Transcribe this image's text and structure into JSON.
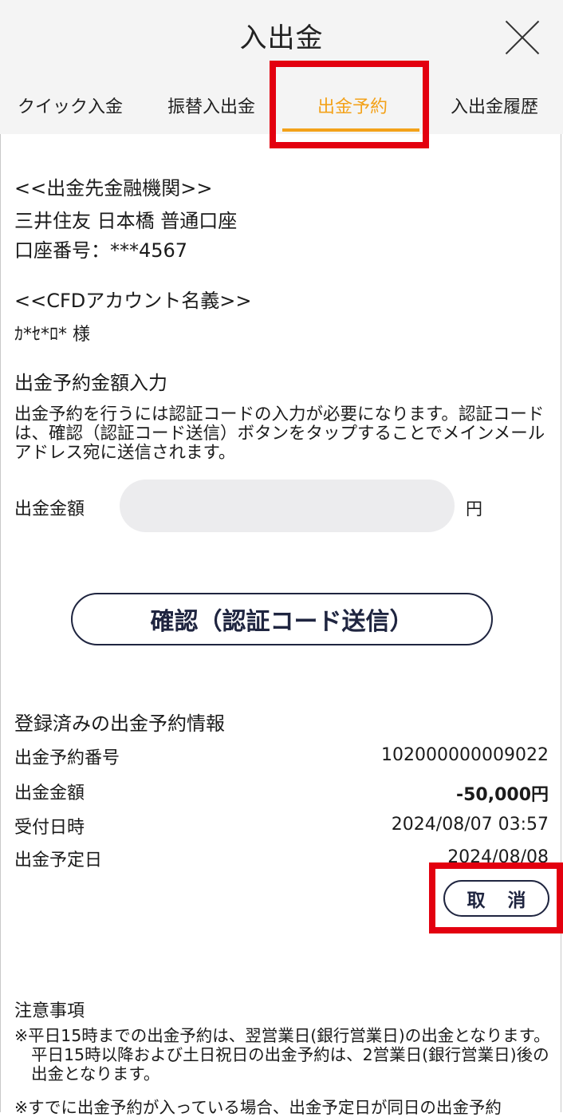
{
  "header": {
    "title": "入出金",
    "tabs": [
      {
        "label": "クイック入金"
      },
      {
        "label": "振替入出金"
      },
      {
        "label": "出金予約"
      },
      {
        "label": "入出金履歴"
      }
    ],
    "active_tab": "出金予約"
  },
  "bank": {
    "heading": "<<出金先金融機関>>",
    "name_line": "三井住友 日本橋 普通口座",
    "account_line": "口座番号：***4567"
  },
  "account": {
    "heading": "<<CFDアカウント名義>>",
    "holder": "ｶ*ｾ*ﾛ* 様"
  },
  "withdraw_input": {
    "heading": "出金予約金額入力",
    "description": "出金予約を行うには認証コードの入力が必要になります。認証コードは、確認（認証コード送信）ボタンをタップすることでメインメールアドレス宛に送信されます。",
    "amount_label": "出金金額",
    "amount_value": "",
    "unit": "円",
    "confirm_button": "確認（認証コード送信）"
  },
  "registered": {
    "heading": "登録済みの出金予約情報",
    "rows": [
      {
        "label": "出金予約番号",
        "value": "102000000009022"
      },
      {
        "label": "出金金額",
        "value": "-50,000円"
      },
      {
        "label": "受付日時",
        "value": "2024/08/07 03:57"
      },
      {
        "label": "出金予定日",
        "value": "2024/08/08"
      }
    ],
    "cancel_button": "取 消"
  },
  "notes": {
    "heading": "注意事項",
    "items": [
      "※平日15時までの出金予約は、翌営業日(銀行営業日)の出金となります。平日15時以降および土日祝日の出金予約は、2営業日(銀行営業日)後の出金となります。",
      "※すでに出金予約が入っている場合、出金予定日が同日の出金予約"
    ]
  },
  "colors": {
    "accent": "#f3a21a",
    "highlight": "#e3000f",
    "button_border": "#1f2540",
    "header_bg": "#f4f4f4",
    "input_bg": "#ececee"
  }
}
